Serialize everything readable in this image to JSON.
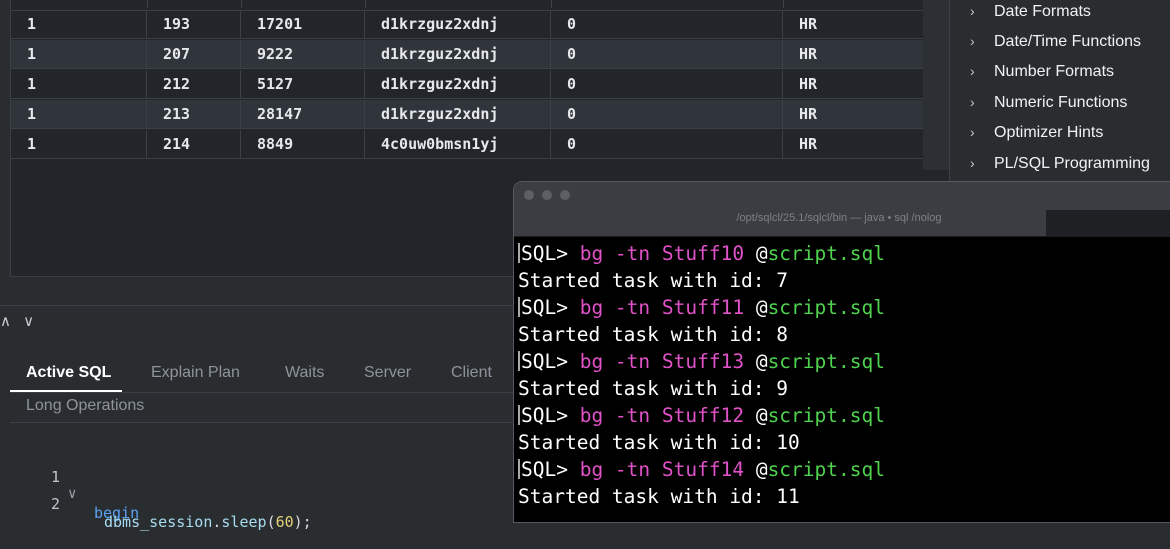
{
  "grid": {
    "rows": [
      [
        "1",
        "193",
        "17201",
        "d1krzguz2xdnj",
        "0",
        "HR"
      ],
      [
        "1",
        "207",
        "9222",
        "d1krzguz2xdnj",
        "0",
        "HR"
      ],
      [
        "1",
        "212",
        "5127",
        "d1krzguz2xdnj",
        "0",
        "HR"
      ],
      [
        "1",
        "213",
        "28147",
        "d1krzguz2xdnj",
        "0",
        "HR"
      ],
      [
        "1",
        "214",
        "8849",
        "4c0uw0bmsn1yj",
        "0",
        "HR"
      ]
    ]
  },
  "snippets": {
    "items": [
      "Date Formats",
      "Date/Time Functions",
      "Number Formats",
      "Numeric Functions",
      "Optimizer Hints",
      "PL/SQL Programming"
    ]
  },
  "panel": {
    "collapse_icons": "∧ ∨",
    "tabs": [
      "Active SQL",
      "Explain Plan",
      "Waits",
      "Server",
      "Client",
      "Long Operations"
    ],
    "code": [
      {
        "line": "1",
        "fold": "∨",
        "keyword": "begin",
        "fn": "",
        "sep": "",
        "method": "",
        "arg": "",
        "tail": ""
      },
      {
        "line": "2",
        "fold": "",
        "keyword": "",
        "fn": "dbms_session",
        "sep": ".",
        "method": "sleep",
        "arg": "60",
        "tail": ");"
      }
    ]
  },
  "terminal": {
    "title": "/opt/sqlcl/25.1/sqlcl/bin — java • sql /nolog",
    "prompt": "SQL> ",
    "command": "bg",
    "flag": " -tn ",
    "at": " @",
    "file": "script.sql",
    "lines": [
      {
        "task": "Stuff10",
        "output": "Started task with id: 7"
      },
      {
        "task": "Stuff11",
        "output": "Started task with id: 8"
      },
      {
        "task": "Stuff13",
        "output": "Started task with id: 9"
      },
      {
        "task": "Stuff12",
        "output": "Started task with id: 10"
      },
      {
        "task": "Stuff14",
        "output": "Started task with id: 11"
      }
    ]
  },
  "colors": {
    "accent_keyword": "#5aa2f5",
    "terminal_command": "#e052c8",
    "terminal_file": "#4fd34f"
  }
}
